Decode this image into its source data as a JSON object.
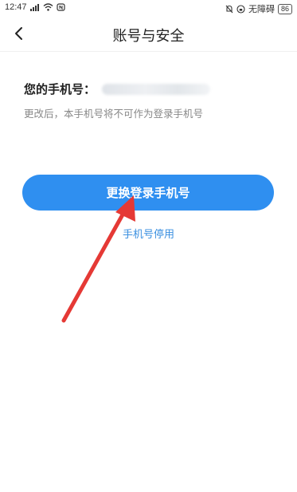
{
  "status_bar": {
    "time": "12:47",
    "accessibility_text": "无障碍",
    "battery": "86"
  },
  "header": {
    "title": "账号与安全",
    "back_icon": "chevron-left-icon"
  },
  "account": {
    "phone_label": "您的手机号：",
    "hint": "更改后，本手机号将不可作为登录手机号"
  },
  "actions": {
    "change_phone_label": "更换登录手机号",
    "deactivate_phone_label": "手机号停用"
  },
  "colors": {
    "primary": "#2f8ff0",
    "link": "#3a8fe0",
    "annotation_arrow": "#e53935"
  }
}
